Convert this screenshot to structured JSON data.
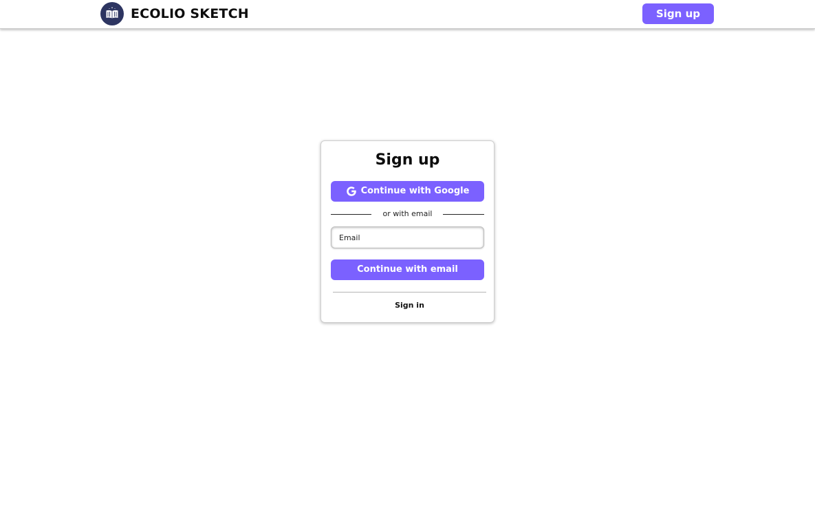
{
  "header": {
    "brand_name": "ECOLIO SKETCH",
    "logo_icon": "open-book-icon",
    "signup_button_label": "Sign up"
  },
  "card": {
    "title": "Sign up",
    "google_button": {
      "icon": "google-icon",
      "label": "Continue with Google"
    },
    "divider_text": "or with email",
    "email_field": {
      "value": "",
      "placeholder": "Email"
    },
    "email_button_label": "Continue with email",
    "signin_link_label": "Sign in"
  },
  "colors": {
    "accent": "#7b61ff",
    "logo_background": "#2d3561",
    "page_background": "#ffffff"
  }
}
